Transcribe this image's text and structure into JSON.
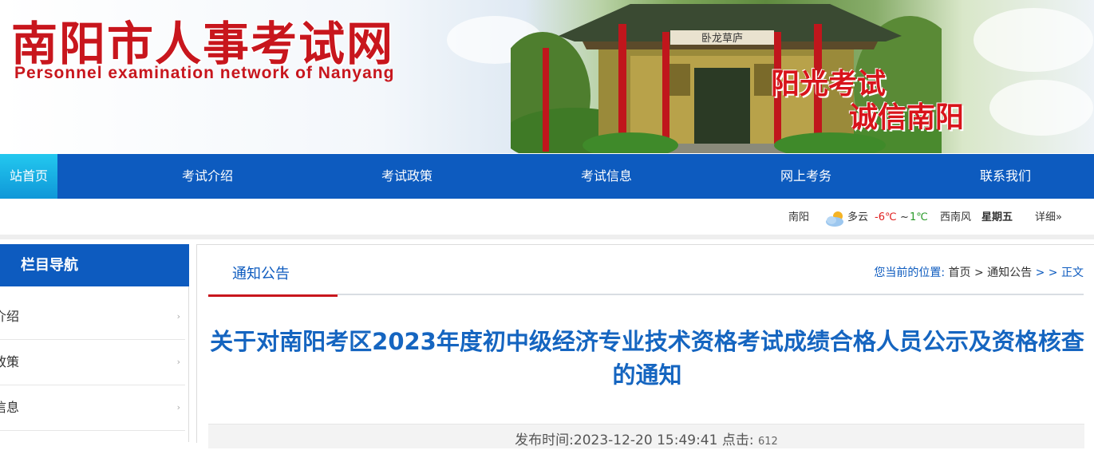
{
  "header": {
    "title": "南阳市人事考试网",
    "subtitle": "Personnel examination network of Nanyang",
    "slogan_line1": "阳光考试",
    "slogan_line2": "诚信南阳",
    "pavilion_plaque": "卧龙草庐"
  },
  "nav": {
    "items": [
      "站首页",
      "考试介绍",
      "考试政策",
      "考试信息",
      "网上考务",
      "联系我们"
    ]
  },
  "weather": {
    "city": "南阳",
    "condition": "多云",
    "temp_low": "-6℃",
    "temp_sep": "~",
    "temp_high": "1℃",
    "wind": "西南风",
    "weekday": "星期五",
    "detail_link": "详细»",
    "low_color": "#e02020",
    "high_color": "#2a9a2a"
  },
  "sidebar": {
    "title": "栏目导航",
    "items": [
      {
        "label": "介绍",
        "arrow": "›"
      },
      {
        "label": "政策",
        "arrow": "›"
      },
      {
        "label": "信息",
        "arrow": "›"
      }
    ]
  },
  "main": {
    "tab": "通知公告",
    "breadcrumb": {
      "prefix": "您当前的位置:",
      "home": "首页",
      "sep1": ">",
      "section": "通知公告",
      "sep2": "> >",
      "current": "正文"
    },
    "article_title": "关于对南阳考区2023年度初中级经济专业技术资格考试成绩合格人员公示及资格核查的通知",
    "meta": {
      "publish_label": "发布时间:",
      "publish_time": "2023-12-20 15:49:41",
      "clicks_label": "点击:",
      "clicks": "612"
    }
  },
  "colors": {
    "brand_red": "#c8161d",
    "nav_blue": "#0d5bbf",
    "home_cyan": "#1bb5e6",
    "title_blue": "#1565c0"
  }
}
